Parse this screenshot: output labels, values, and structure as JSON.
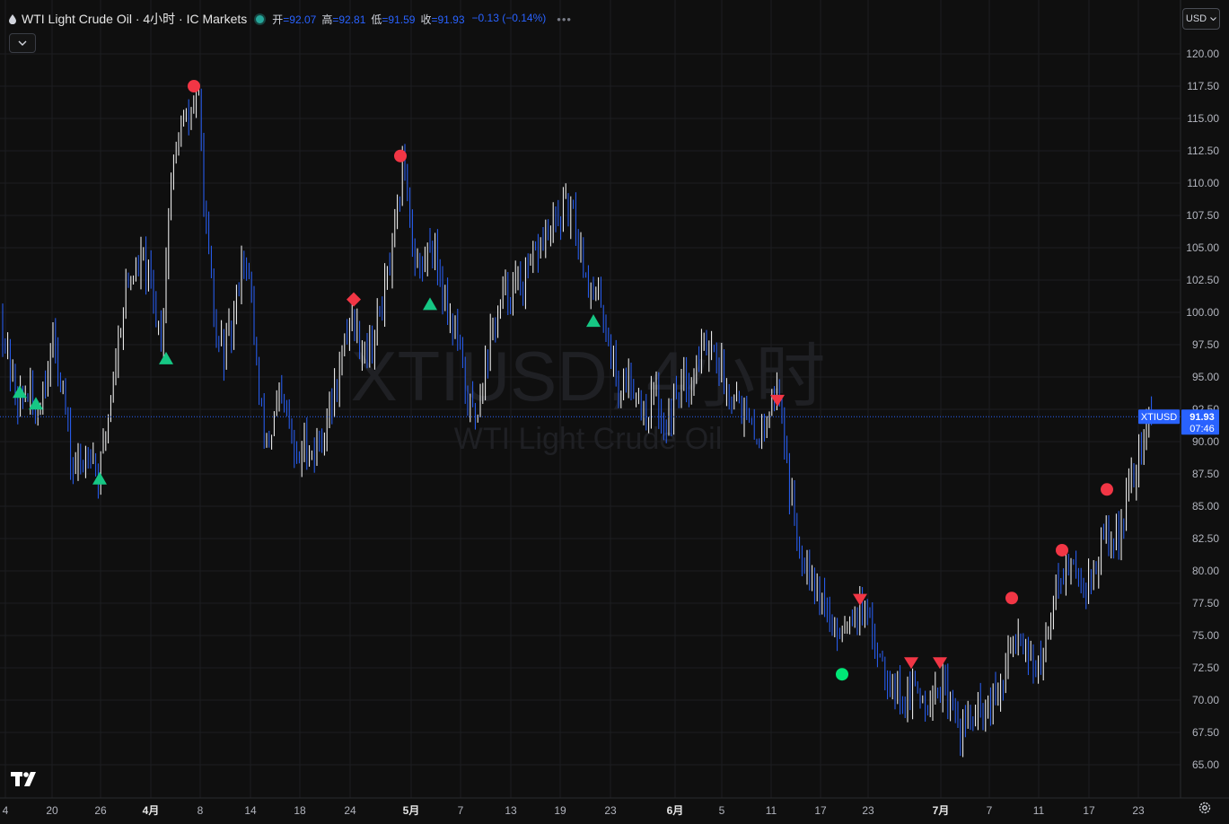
{
  "header": {
    "title": "WTI Light Crude Oil · 4小时 · IC Markets",
    "open_label": "开",
    "open_value": "=92.07",
    "high_label": "高",
    "high_value": "=92.81",
    "low_label": "低",
    "low_value": "=91.59",
    "close_label": "收",
    "close_value": "=91.93",
    "change": "−0.13 (−0.14%)"
  },
  "currency": "USD",
  "watermark": {
    "symbol": "XTIUSD, 4小时",
    "name": "WTI Light Crude Oil"
  },
  "price_badge": {
    "symbol": "XTIUSD",
    "price": "91.93",
    "countdown": "07:46"
  },
  "colors": {
    "background": "#0f0f0f",
    "candle_up": "#ffffff",
    "candle_down": "#2962ff",
    "marker_red": "#f23645",
    "marker_green": "#00e676",
    "grid": "#1f2023"
  },
  "icons": {
    "title": "drop-icon",
    "logo": "tradingview-logo-icon",
    "settings": "gear-icon"
  },
  "chart_data": {
    "type": "candlestick",
    "symbol": "XTIUSD",
    "timeframe": "4小时",
    "y_ticks": [
      "120.00",
      "117.50",
      "115.00",
      "112.50",
      "110.00",
      "107.50",
      "105.00",
      "102.50",
      "100.00",
      "97.50",
      "95.00",
      "92.50",
      "90.00",
      "87.50",
      "85.00",
      "82.50",
      "80.00",
      "77.50",
      "75.00",
      "72.50",
      "70.00",
      "67.50",
      "65.00"
    ],
    "ylim": [
      63.5,
      122.0
    ],
    "x_ticks": [
      "4",
      "20",
      "26",
      "4月",
      "8",
      "14",
      "18",
      "24",
      "5月",
      "7",
      "13",
      "19",
      "23",
      "6月",
      "5",
      "11",
      "17",
      "23",
      "7月",
      "7",
      "11",
      "17",
      "23"
    ],
    "last_price": 91.93,
    "path": [
      [
        0,
        100
      ],
      [
        10,
        96
      ],
      [
        20,
        93
      ],
      [
        30,
        94
      ],
      [
        40,
        92
      ],
      [
        50,
        95
      ],
      [
        60,
        98
      ],
      [
        70,
        94
      ],
      [
        80,
        88
      ],
      [
        90,
        88
      ],
      [
        100,
        90
      ],
      [
        110,
        87
      ],
      [
        120,
        92
      ],
      [
        130,
        97
      ],
      [
        140,
        102
      ],
      [
        150,
        103
      ],
      [
        160,
        104
      ],
      [
        170,
        101
      ],
      [
        180,
        98
      ],
      [
        190,
        110
      ],
      [
        200,
        114
      ],
      [
        210,
        115
      ],
      [
        220,
        117.5
      ],
      [
        230,
        106
      ],
      [
        240,
        98
      ],
      [
        250,
        97
      ],
      [
        260,
        99
      ],
      [
        270,
        105
      ],
      [
        280,
        101
      ],
      [
        290,
        92
      ],
      [
        300,
        90
      ],
      [
        310,
        93
      ],
      [
        320,
        92
      ],
      [
        330,
        88
      ],
      [
        340,
        90
      ],
      [
        350,
        89
      ],
      [
        360,
        91
      ],
      [
        370,
        93
      ],
      [
        380,
        96
      ],
      [
        390,
        100
      ],
      [
        400,
        98
      ],
      [
        410,
        97
      ],
      [
        420,
        99
      ],
      [
        430,
        102
      ],
      [
        440,
        106
      ],
      [
        450,
        112
      ],
      [
        460,
        105
      ],
      [
        470,
        103
      ],
      [
        480,
        106
      ],
      [
        490,
        103
      ],
      [
        500,
        100
      ],
      [
        510,
        98
      ],
      [
        520,
        93
      ],
      [
        530,
        92
      ],
      [
        540,
        96
      ],
      [
        550,
        99
      ],
      [
        560,
        101
      ],
      [
        570,
        102
      ],
      [
        580,
        102
      ],
      [
        590,
        103
      ],
      [
        600,
        105
      ],
      [
        610,
        106
      ],
      [
        620,
        107
      ],
      [
        630,
        108
      ],
      [
        640,
        107
      ],
      [
        650,
        104
      ],
      [
        660,
        101
      ],
      [
        670,
        101
      ],
      [
        680,
        97
      ],
      [
        690,
        94
      ],
      [
        700,
        95
      ],
      [
        710,
        94
      ],
      [
        720,
        92
      ],
      [
        730,
        94
      ],
      [
        740,
        91
      ],
      [
        750,
        93
      ],
      [
        760,
        95
      ],
      [
        770,
        95
      ],
      [
        780,
        97
      ],
      [
        790,
        98
      ],
      [
        800,
        96
      ],
      [
        810,
        94
      ],
      [
        820,
        94
      ],
      [
        830,
        92
      ],
      [
        840,
        90
      ],
      [
        850,
        91
      ],
      [
        860,
        94
      ],
      [
        870,
        93
      ],
      [
        880,
        86
      ],
      [
        890,
        82
      ],
      [
        900,
        81
      ],
      [
        910,
        79
      ],
      [
        920,
        77
      ],
      [
        930,
        75
      ],
      [
        940,
        76
      ],
      [
        950,
        77
      ],
      [
        960,
        77
      ],
      [
        970,
        75
      ],
      [
        980,
        74
      ],
      [
        990,
        72
      ],
      [
        1000,
        71
      ],
      [
        1010,
        70
      ],
      [
        1020,
        71
      ],
      [
        1030,
        70
      ],
      [
        1040,
        71
      ],
      [
        1050,
        71
      ],
      [
        1060,
        69
      ],
      [
        1070,
        68
      ],
      [
        1080,
        68.5
      ],
      [
        1090,
        69
      ],
      [
        1100,
        69
      ],
      [
        1110,
        70
      ],
      [
        1120,
        72
      ],
      [
        1130,
        75
      ],
      [
        1140,
        75
      ],
      [
        1150,
        73
      ],
      [
        1160,
        72
      ],
      [
        1170,
        77
      ],
      [
        1180,
        80
      ],
      [
        1190,
        80
      ],
      [
        1200,
        80
      ],
      [
        1210,
        79
      ],
      [
        1220,
        80
      ],
      [
        1230,
        83
      ],
      [
        1240,
        82
      ],
      [
        1250,
        84
      ],
      [
        1260,
        87
      ],
      [
        1270,
        89
      ],
      [
        1280,
        92
      ]
    ],
    "markers": [
      {
        "shape": "triangle-up",
        "color": "green",
        "x": 22,
        "price": 93.8
      },
      {
        "shape": "triangle-up",
        "color": "green",
        "x": 40,
        "price": 92.9
      },
      {
        "shape": "triangle-up",
        "color": "green",
        "x": 111,
        "price": 87.1
      },
      {
        "shape": "triangle-up",
        "color": "green",
        "x": 185,
        "price": 96.4
      },
      {
        "shape": "triangle-up",
        "color": "green",
        "x": 479,
        "price": 100.6
      },
      {
        "shape": "triangle-up",
        "color": "green",
        "x": 661,
        "price": 99.3
      },
      {
        "shape": "circle",
        "color": "red",
        "x": 216,
        "price": 117.5
      },
      {
        "shape": "circle",
        "color": "red",
        "x": 446,
        "price": 112.1
      },
      {
        "shape": "diamond",
        "color": "red",
        "x": 394,
        "price": 101.0
      },
      {
        "shape": "triangle-down",
        "color": "red",
        "x": 866,
        "price": 93.2
      },
      {
        "shape": "triangle-down",
        "color": "red",
        "x": 958,
        "price": 77.8
      },
      {
        "shape": "triangle-down",
        "color": "red",
        "x": 1015,
        "price": 72.9
      },
      {
        "shape": "triangle-down",
        "color": "red",
        "x": 1047,
        "price": 72.9
      },
      {
        "shape": "circle",
        "color": "green",
        "x": 938,
        "price": 72.0
      },
      {
        "shape": "circle",
        "color": "red",
        "x": 1127,
        "price": 77.9
      },
      {
        "shape": "circle",
        "color": "red",
        "x": 1183,
        "price": 81.6
      },
      {
        "shape": "circle",
        "color": "red",
        "x": 1233,
        "price": 86.3
      }
    ]
  }
}
